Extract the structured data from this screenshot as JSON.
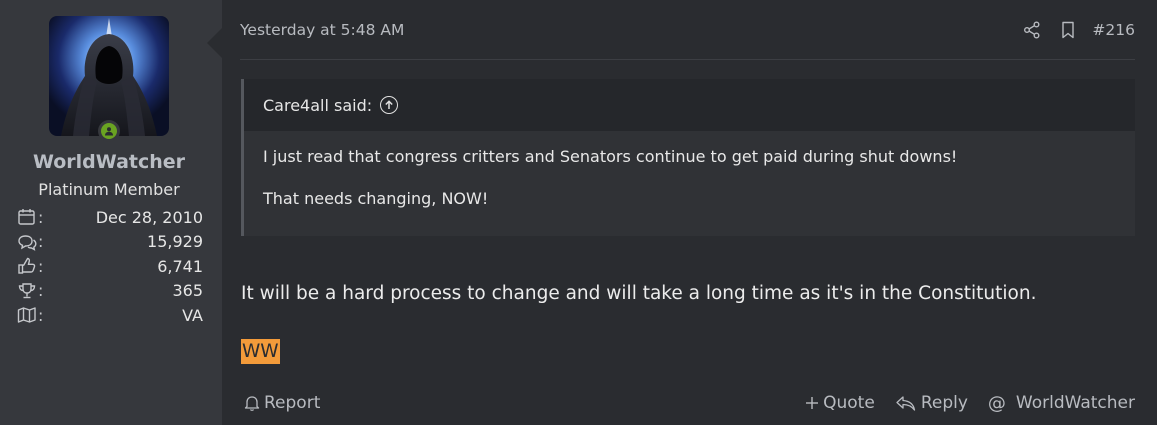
{
  "user": {
    "name": "WorldWatcher",
    "title": "Platinum Member",
    "online": true,
    "stats": [
      {
        "icon": "calendar-icon",
        "label": ":",
        "value": "Dec 28, 2010"
      },
      {
        "icon": "messages-icon",
        "label": ":",
        "value": "15,929"
      },
      {
        "icon": "thumbs-up-icon",
        "label": ":",
        "value": "6,741"
      },
      {
        "icon": "trophy-icon",
        "label": ":",
        "value": "365"
      },
      {
        "icon": "map-icon",
        "label": ":",
        "value": "VA"
      }
    ]
  },
  "post": {
    "date": "Yesterday at 5:48 AM",
    "number": "#216",
    "quote": {
      "author_line": "Care4all said:",
      "lines": [
        "I just read that congress critters and Senators continue to get paid during shut downs!",
        "That needs changing, NOW!"
      ]
    },
    "body": "It will be a hard process to change and will take a long time as it's in the Constitution.",
    "signature": "WW"
  },
  "actions": {
    "report": "Report",
    "quote": "Quote",
    "reply": "Reply",
    "mention": "WorldWatcher"
  },
  "colors": {
    "background": "#2a2c30",
    "sidebar": "#36383d",
    "signature_highlight": "#f39b3a",
    "online": "#6aa322"
  }
}
